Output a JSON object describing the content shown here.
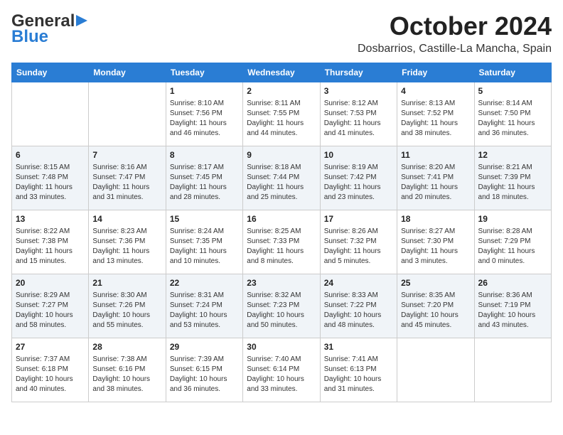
{
  "logo": {
    "line1": "General",
    "line2": "Blue"
  },
  "title": "October 2024",
  "subtitle": "Dosbarrios, Castille-La Mancha, Spain",
  "days_of_week": [
    "Sunday",
    "Monday",
    "Tuesday",
    "Wednesday",
    "Thursday",
    "Friday",
    "Saturday"
  ],
  "weeks": [
    [
      {
        "day": "",
        "sunrise": "",
        "sunset": "",
        "daylight": ""
      },
      {
        "day": "",
        "sunrise": "",
        "sunset": "",
        "daylight": ""
      },
      {
        "day": "1",
        "sunrise": "Sunrise: 8:10 AM",
        "sunset": "Sunset: 7:56 PM",
        "daylight": "Daylight: 11 hours and 46 minutes."
      },
      {
        "day": "2",
        "sunrise": "Sunrise: 8:11 AM",
        "sunset": "Sunset: 7:55 PM",
        "daylight": "Daylight: 11 hours and 44 minutes."
      },
      {
        "day": "3",
        "sunrise": "Sunrise: 8:12 AM",
        "sunset": "Sunset: 7:53 PM",
        "daylight": "Daylight: 11 hours and 41 minutes."
      },
      {
        "day": "4",
        "sunrise": "Sunrise: 8:13 AM",
        "sunset": "Sunset: 7:52 PM",
        "daylight": "Daylight: 11 hours and 38 minutes."
      },
      {
        "day": "5",
        "sunrise": "Sunrise: 8:14 AM",
        "sunset": "Sunset: 7:50 PM",
        "daylight": "Daylight: 11 hours and 36 minutes."
      }
    ],
    [
      {
        "day": "6",
        "sunrise": "Sunrise: 8:15 AM",
        "sunset": "Sunset: 7:48 PM",
        "daylight": "Daylight: 11 hours and 33 minutes."
      },
      {
        "day": "7",
        "sunrise": "Sunrise: 8:16 AM",
        "sunset": "Sunset: 7:47 PM",
        "daylight": "Daylight: 11 hours and 31 minutes."
      },
      {
        "day": "8",
        "sunrise": "Sunrise: 8:17 AM",
        "sunset": "Sunset: 7:45 PM",
        "daylight": "Daylight: 11 hours and 28 minutes."
      },
      {
        "day": "9",
        "sunrise": "Sunrise: 8:18 AM",
        "sunset": "Sunset: 7:44 PM",
        "daylight": "Daylight: 11 hours and 25 minutes."
      },
      {
        "day": "10",
        "sunrise": "Sunrise: 8:19 AM",
        "sunset": "Sunset: 7:42 PM",
        "daylight": "Daylight: 11 hours and 23 minutes."
      },
      {
        "day": "11",
        "sunrise": "Sunrise: 8:20 AM",
        "sunset": "Sunset: 7:41 PM",
        "daylight": "Daylight: 11 hours and 20 minutes."
      },
      {
        "day": "12",
        "sunrise": "Sunrise: 8:21 AM",
        "sunset": "Sunset: 7:39 PM",
        "daylight": "Daylight: 11 hours and 18 minutes."
      }
    ],
    [
      {
        "day": "13",
        "sunrise": "Sunrise: 8:22 AM",
        "sunset": "Sunset: 7:38 PM",
        "daylight": "Daylight: 11 hours and 15 minutes."
      },
      {
        "day": "14",
        "sunrise": "Sunrise: 8:23 AM",
        "sunset": "Sunset: 7:36 PM",
        "daylight": "Daylight: 11 hours and 13 minutes."
      },
      {
        "day": "15",
        "sunrise": "Sunrise: 8:24 AM",
        "sunset": "Sunset: 7:35 PM",
        "daylight": "Daylight: 11 hours and 10 minutes."
      },
      {
        "day": "16",
        "sunrise": "Sunrise: 8:25 AM",
        "sunset": "Sunset: 7:33 PM",
        "daylight": "Daylight: 11 hours and 8 minutes."
      },
      {
        "day": "17",
        "sunrise": "Sunrise: 8:26 AM",
        "sunset": "Sunset: 7:32 PM",
        "daylight": "Daylight: 11 hours and 5 minutes."
      },
      {
        "day": "18",
        "sunrise": "Sunrise: 8:27 AM",
        "sunset": "Sunset: 7:30 PM",
        "daylight": "Daylight: 11 hours and 3 minutes."
      },
      {
        "day": "19",
        "sunrise": "Sunrise: 8:28 AM",
        "sunset": "Sunset: 7:29 PM",
        "daylight": "Daylight: 11 hours and 0 minutes."
      }
    ],
    [
      {
        "day": "20",
        "sunrise": "Sunrise: 8:29 AM",
        "sunset": "Sunset: 7:27 PM",
        "daylight": "Daylight: 10 hours and 58 minutes."
      },
      {
        "day": "21",
        "sunrise": "Sunrise: 8:30 AM",
        "sunset": "Sunset: 7:26 PM",
        "daylight": "Daylight: 10 hours and 55 minutes."
      },
      {
        "day": "22",
        "sunrise": "Sunrise: 8:31 AM",
        "sunset": "Sunset: 7:24 PM",
        "daylight": "Daylight: 10 hours and 53 minutes."
      },
      {
        "day": "23",
        "sunrise": "Sunrise: 8:32 AM",
        "sunset": "Sunset: 7:23 PM",
        "daylight": "Daylight: 10 hours and 50 minutes."
      },
      {
        "day": "24",
        "sunrise": "Sunrise: 8:33 AM",
        "sunset": "Sunset: 7:22 PM",
        "daylight": "Daylight: 10 hours and 48 minutes."
      },
      {
        "day": "25",
        "sunrise": "Sunrise: 8:35 AM",
        "sunset": "Sunset: 7:20 PM",
        "daylight": "Daylight: 10 hours and 45 minutes."
      },
      {
        "day": "26",
        "sunrise": "Sunrise: 8:36 AM",
        "sunset": "Sunset: 7:19 PM",
        "daylight": "Daylight: 10 hours and 43 minutes."
      }
    ],
    [
      {
        "day": "27",
        "sunrise": "Sunrise: 7:37 AM",
        "sunset": "Sunset: 6:18 PM",
        "daylight": "Daylight: 10 hours and 40 minutes."
      },
      {
        "day": "28",
        "sunrise": "Sunrise: 7:38 AM",
        "sunset": "Sunset: 6:16 PM",
        "daylight": "Daylight: 10 hours and 38 minutes."
      },
      {
        "day": "29",
        "sunrise": "Sunrise: 7:39 AM",
        "sunset": "Sunset: 6:15 PM",
        "daylight": "Daylight: 10 hours and 36 minutes."
      },
      {
        "day": "30",
        "sunrise": "Sunrise: 7:40 AM",
        "sunset": "Sunset: 6:14 PM",
        "daylight": "Daylight: 10 hours and 33 minutes."
      },
      {
        "day": "31",
        "sunrise": "Sunrise: 7:41 AM",
        "sunset": "Sunset: 6:13 PM",
        "daylight": "Daylight: 10 hours and 31 minutes."
      },
      {
        "day": "",
        "sunrise": "",
        "sunset": "",
        "daylight": ""
      },
      {
        "day": "",
        "sunrise": "",
        "sunset": "",
        "daylight": ""
      }
    ]
  ]
}
